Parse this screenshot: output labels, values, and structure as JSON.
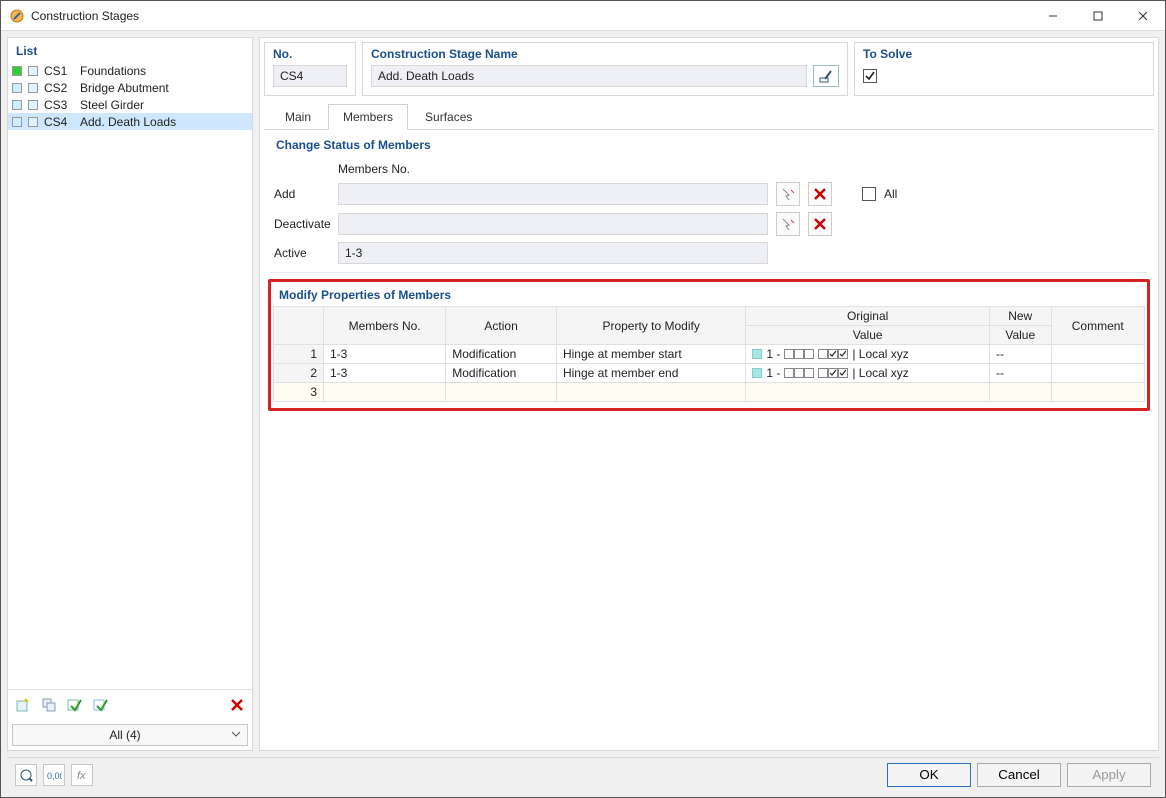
{
  "title": "Construction Stages",
  "left": {
    "header": "List",
    "items": [
      {
        "swatch": "#33cc33",
        "code": "CS1",
        "name": "Foundations",
        "selected": false
      },
      {
        "swatch": "#cceeff",
        "code": "CS2",
        "name": "Bridge Abutment",
        "selected": false
      },
      {
        "swatch": "#cceeff",
        "code": "CS3",
        "name": "Steel Girder",
        "selected": false
      },
      {
        "swatch": "#cceeff",
        "code": "CS4",
        "name": "Add. Death Loads",
        "selected": true
      }
    ],
    "footer_combo": "All (4)"
  },
  "meta": {
    "no_label": "No.",
    "no_value": "CS4",
    "name_label": "Construction Stage Name",
    "name_value": "Add. Death Loads",
    "solve_label": "To Solve",
    "solve_checked": true
  },
  "tabs": [
    {
      "label": "Main",
      "active": false
    },
    {
      "label": "Members",
      "active": true
    },
    {
      "label": "Surfaces",
      "active": false
    }
  ],
  "change_status": {
    "header": "Change Status of Members",
    "members_no_label": "Members No.",
    "rows": {
      "add": {
        "label": "Add",
        "value": ""
      },
      "deactivate": {
        "label": "Deactivate",
        "value": ""
      },
      "active": {
        "label": "Active",
        "value": "1-3"
      }
    },
    "all_label": "All",
    "all_checked": false
  },
  "modify": {
    "header": "Modify Properties of Members",
    "columns": {
      "members_no": "Members No.",
      "action": "Action",
      "property": "Property to Modify",
      "orig_value_l1": "Original",
      "orig_value_l2": "Value",
      "new_value_l1": "New",
      "new_value_l2": "Value",
      "comment": "Comment"
    },
    "rows": [
      {
        "n": "1",
        "members_no": "1-3",
        "action": "Modification",
        "property": "Hinge at member start",
        "orig_value_prefix": "1 -",
        "orig_value_flags1": [
          false,
          false,
          false
        ],
        "orig_value_flags2": [
          false,
          true,
          true
        ],
        "orig_value_suffix": "| Local xyz",
        "new_value": "--",
        "comment": ""
      },
      {
        "n": "2",
        "members_no": "1-3",
        "action": "Modification",
        "property": "Hinge at member end",
        "orig_value_prefix": "1 -",
        "orig_value_flags1": [
          false,
          false,
          false
        ],
        "orig_value_flags2": [
          false,
          true,
          true
        ],
        "orig_value_suffix": "| Local xyz",
        "new_value": "--",
        "comment": ""
      },
      {
        "n": "3",
        "empty": true
      }
    ]
  },
  "buttons": {
    "ok": "OK",
    "cancel": "Cancel",
    "apply": "Apply"
  }
}
